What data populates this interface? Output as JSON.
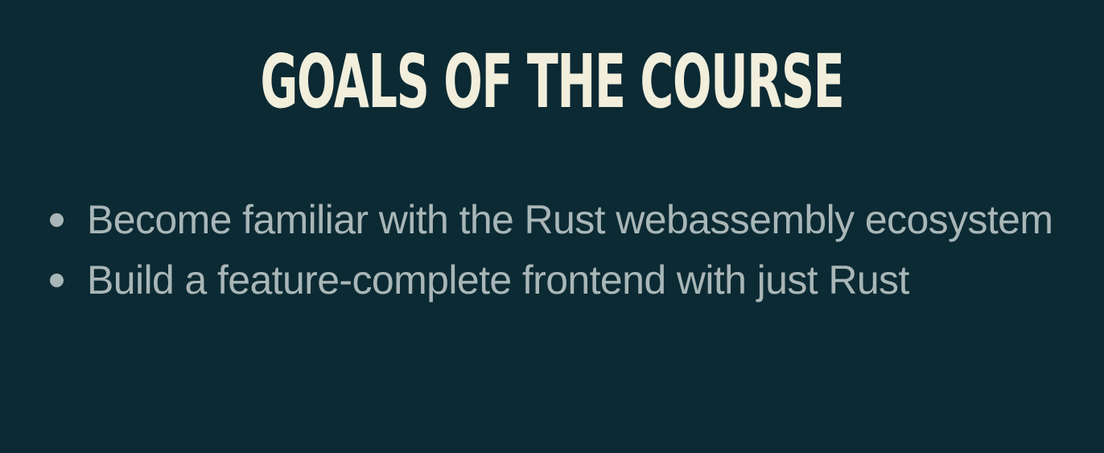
{
  "slide": {
    "title": "GOALS OF THE COURSE",
    "bullets": [
      {
        "text": "Become familiar with the Rust webassembly ecosystem"
      },
      {
        "text": "Build a feature-complete frontend with just Rust"
      }
    ]
  },
  "colors": {
    "background": "#0c2a33",
    "title": "#f1eedc",
    "body_text": "#a9b6b7"
  }
}
